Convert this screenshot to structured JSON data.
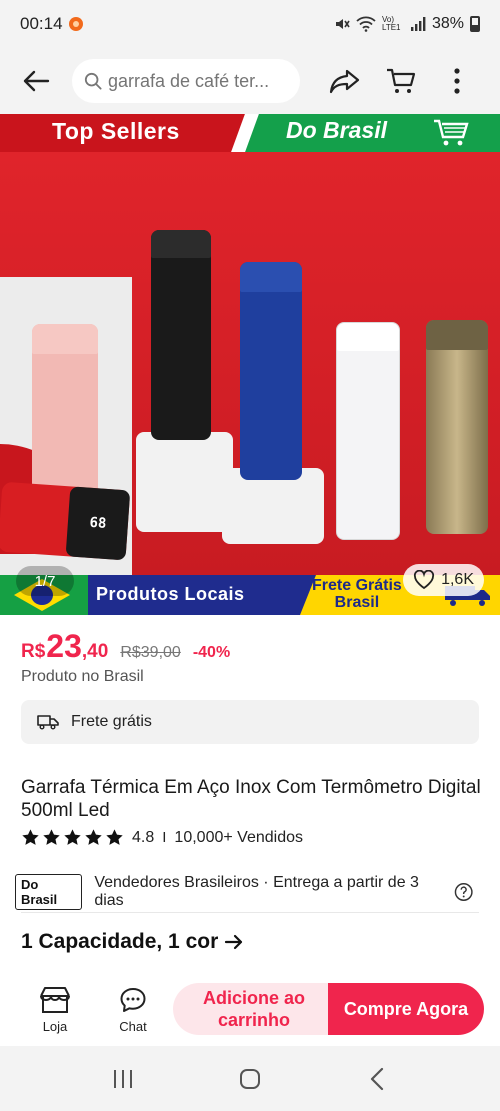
{
  "status_bar": {
    "time": "00:14",
    "network_label": "Vo) LTE1",
    "battery": "38%"
  },
  "top_nav": {
    "search_placeholder": "garrafa de café ter..."
  },
  "product_image": {
    "banner_top_left": "Top Sellers",
    "banner_top_right": "Do Brasil",
    "banner_bottom_left": "Produtos Locais",
    "banner_bottom_right_line1": "Frete Grátis",
    "banner_bottom_right_line2": "Brasil",
    "thermo_display": "68",
    "counter": "1/7",
    "likes": "1,6K"
  },
  "price": {
    "currency": "R$",
    "integer": "23",
    "cents": ",40",
    "original": "R$39,00",
    "discount": "-40%"
  },
  "origin_note": "Produto no Brasil",
  "shipping": {
    "label": "Frete grátis"
  },
  "product": {
    "title": "Garrafa Térmica Em Aço Inox Com Termômetro Digital 500ml Led",
    "rating": "4.8",
    "rating_separator": "I",
    "sold": "10,000+ Vendidos",
    "stars": 5
  },
  "seller": {
    "badge": "Do Brasil",
    "description": "Vendedores Brasileiros · Entrega a partir de 3 dias"
  },
  "variant": {
    "label": "1 Capacidade, 1 cor"
  },
  "action_bar": {
    "store_label": "Loja",
    "chat_label": "Chat",
    "add_to_cart": "Adicione ao carrinho",
    "buy_now": "Compre Agora"
  },
  "colors": {
    "accent": "#f0254d",
    "accent_light": "#fde6ea",
    "banner_red": "#c9141c",
    "banner_green": "#14a04b",
    "banner_blue": "#1f2c8e",
    "banner_yellow": "#ffd600"
  }
}
